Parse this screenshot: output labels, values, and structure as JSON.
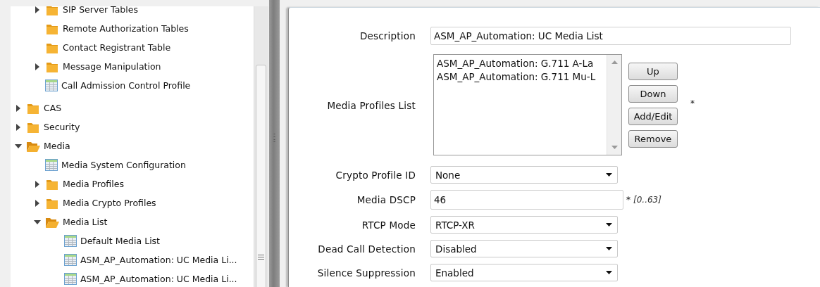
{
  "tree": {
    "continued_children": [
      {
        "label": "SIP Server Tables",
        "kind": "folder",
        "expanded": false
      },
      {
        "label": "Remote Authorization Tables",
        "kind": "folder"
      },
      {
        "label": "Contact Registrant Table",
        "kind": "folder"
      },
      {
        "label": "Message Manipulation",
        "kind": "folder",
        "expanded": false
      },
      {
        "label": "Call Admission Control Profile",
        "kind": "table"
      }
    ],
    "items": [
      {
        "label": "CAS",
        "kind": "folder",
        "expanded": false
      },
      {
        "label": "Security",
        "kind": "folder",
        "expanded": false
      },
      {
        "label": "Media",
        "kind": "folder",
        "expanded": true,
        "children": [
          {
            "label": "Media System Configuration",
            "kind": "table"
          },
          {
            "label": "Media Profiles",
            "kind": "folder",
            "expanded": false
          },
          {
            "label": "Media Crypto Profiles",
            "kind": "folder",
            "expanded": false
          },
          {
            "label": "Media List",
            "kind": "folder",
            "expanded": true,
            "children": [
              {
                "label": "Default Media List",
                "kind": "table"
              },
              {
                "label": "ASM_AP_Automation: UC Media Li...",
                "kind": "table"
              },
              {
                "label": "ASM_AP_Automation: UC Media Li...",
                "kind": "table"
              }
            ]
          }
        ]
      }
    ]
  },
  "form": {
    "fields": [
      {
        "kind": "text",
        "label": "Description",
        "value": "ASM_AP_Automation: UC Media List"
      },
      {
        "kind": "list",
        "label": "Media Profiles List",
        "items": [
          "ASM_AP_Automation: G.711 A-La",
          "ASM_AP_Automation: G.711 Mu-L"
        ],
        "buttons": [
          "Up",
          "Down",
          "Add/Edit",
          "Remove"
        ],
        "marker": "*"
      },
      {
        "kind": "select",
        "label": "Crypto Profile ID",
        "value": "None"
      },
      {
        "kind": "text",
        "label": "Media DSCP",
        "value": "46",
        "marker": "*",
        "hint": "[0..63]"
      },
      {
        "kind": "select",
        "label": "RTCP Mode",
        "value": "RTCP-XR"
      },
      {
        "kind": "select",
        "label": "Dead Call Detection",
        "value": "Disabled"
      },
      {
        "kind": "select",
        "label": "Silence Suppression",
        "value": "Enabled"
      }
    ]
  }
}
